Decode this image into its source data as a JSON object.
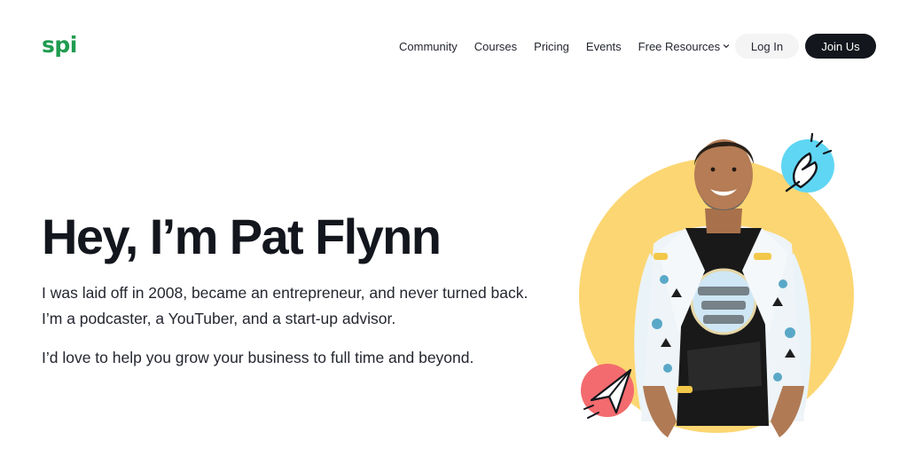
{
  "brand": {
    "logo_text": "spi",
    "color": "#1f9b4f"
  },
  "nav": {
    "items": [
      {
        "label": "Community"
      },
      {
        "label": "Courses"
      },
      {
        "label": "Pricing"
      },
      {
        "label": "Events"
      },
      {
        "label": "Free Resources",
        "has_dropdown": true
      }
    ],
    "login_label": "Log In",
    "join_label": "Join Us"
  },
  "hero": {
    "title_prefix": "Hey, I’m ",
    "title_name": "Pat Flynn",
    "intro": "I was laid off in 2008, became an entrepreneur, and never turned back. I’m a podcaster, a YouTuber, and a start-up advisor.",
    "cta_text": "I’d love to help you grow your business to full time and beyond."
  },
  "colors": {
    "accent_green": "#1f9b4f",
    "scribble": "#cfe6d8",
    "sun_yellow": "#fcd672",
    "sky_blue": "#5fd6f4",
    "coral": "#f36b6e",
    "dark": "#13161d"
  },
  "icons": [
    "snap-fingers-icon",
    "paper-plane-icon",
    "chevron-down-icon"
  ]
}
